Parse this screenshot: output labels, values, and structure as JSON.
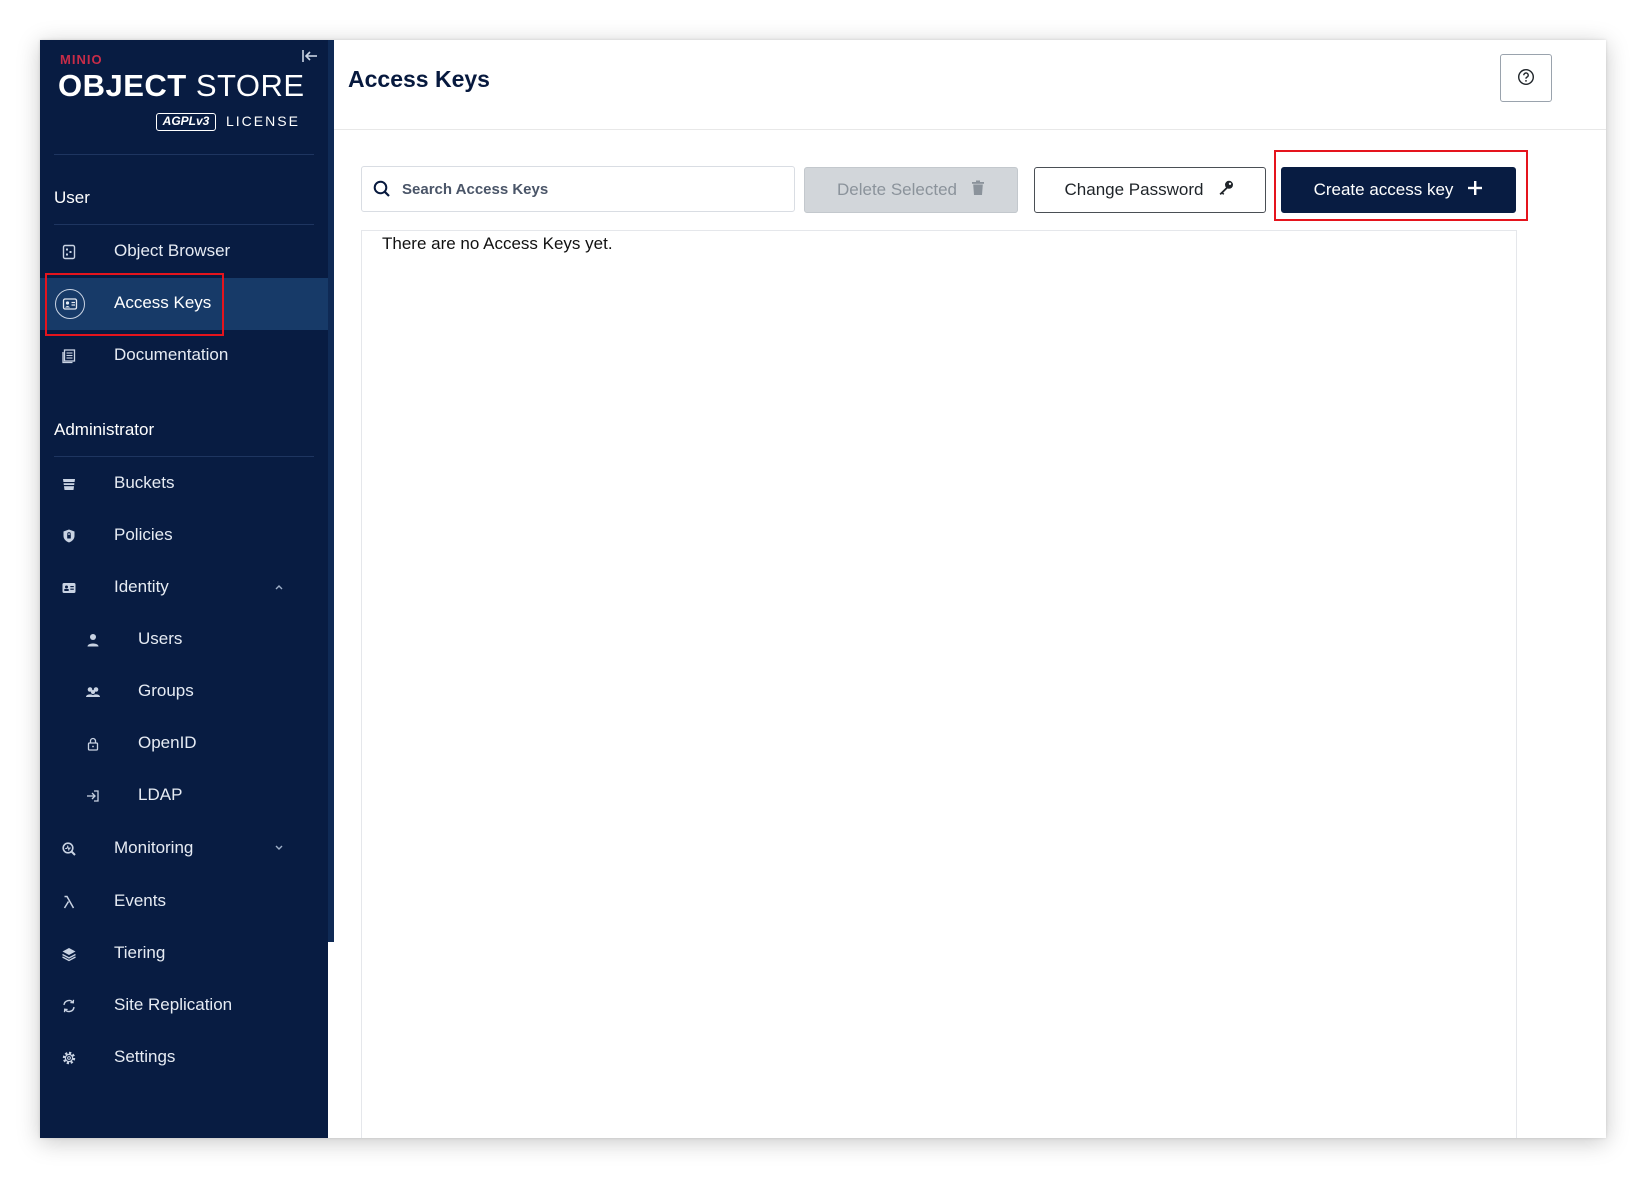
{
  "brand": {
    "company": "MINIO",
    "product_bold": "OBJECT",
    "product_light": " STORE",
    "license_badge": "AGPLv3",
    "license_text": "LICENSE"
  },
  "sidebar": {
    "user_section": {
      "title": "User",
      "items": [
        {
          "label": "Object Browser",
          "icon": "object-browser-icon"
        },
        {
          "label": "Access Keys",
          "icon": "access-keys-icon",
          "active": true
        },
        {
          "label": "Documentation",
          "icon": "documentation-icon"
        }
      ]
    },
    "admin_section": {
      "title": "Administrator",
      "items": [
        {
          "label": "Buckets",
          "icon": "bucket-icon"
        },
        {
          "label": "Policies",
          "icon": "shield-icon"
        },
        {
          "label": "Identity",
          "icon": "identity-icon",
          "expanded": true
        },
        {
          "label": "Users",
          "icon": "user-icon",
          "sub": true
        },
        {
          "label": "Groups",
          "icon": "groups-icon",
          "sub": true
        },
        {
          "label": "OpenID",
          "icon": "lock-icon",
          "sub": true
        },
        {
          "label": "LDAP",
          "icon": "login-icon",
          "sub": true
        },
        {
          "label": "Monitoring",
          "icon": "monitoring-icon",
          "expanded": false
        },
        {
          "label": "Events",
          "icon": "lambda-icon"
        },
        {
          "label": "Tiering",
          "icon": "layers-icon"
        },
        {
          "label": "Site Replication",
          "icon": "replication-icon"
        },
        {
          "label": "Settings",
          "icon": "gear-icon"
        }
      ]
    }
  },
  "header": {
    "title": "Access Keys",
    "help_icon": "question-circle-icon"
  },
  "toolbar": {
    "search_placeholder": "Search Access Keys",
    "delete_label": "Delete Selected",
    "change_password_label": "Change Password",
    "create_label": "Create access key"
  },
  "list": {
    "empty_message": "There are no Access Keys yet."
  },
  "colors": {
    "sidebar_bg": "#081c42",
    "active_item_bg": "#173a68",
    "primary_button": "#081c42",
    "highlight": "#e5141d",
    "brand_red": "#c72c48"
  }
}
